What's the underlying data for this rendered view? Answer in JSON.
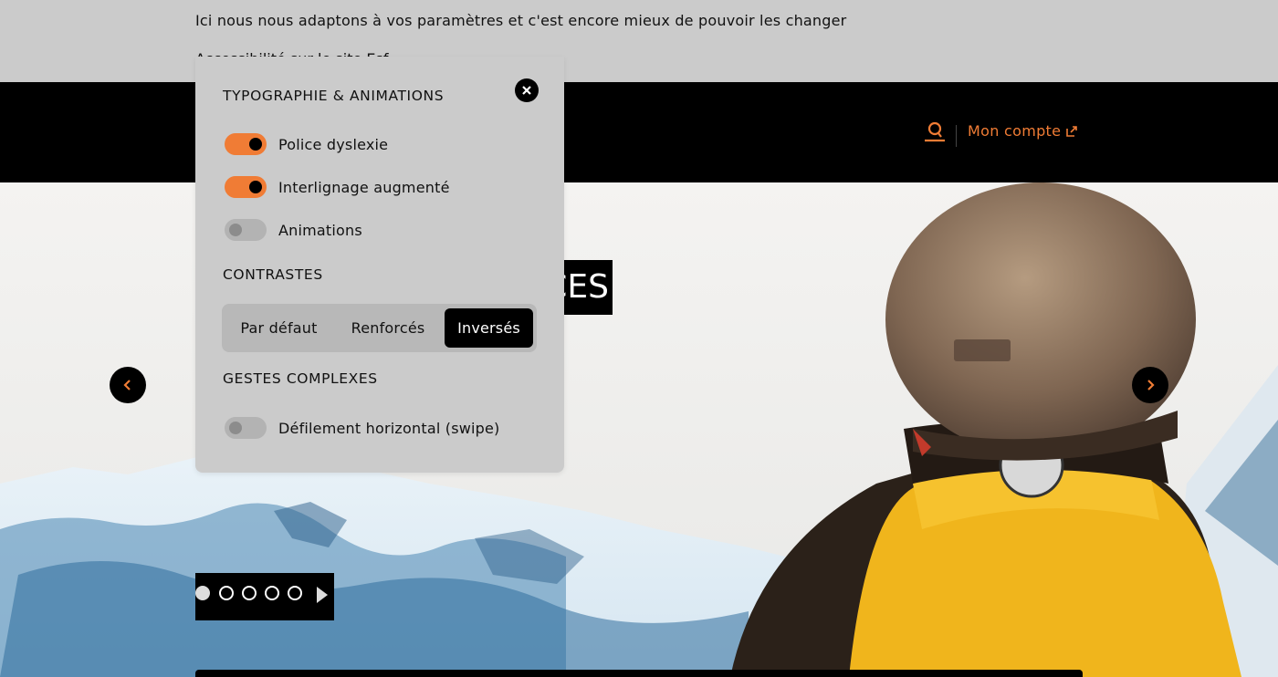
{
  "topbar": {
    "intro_text": "Ici nous nous adaptons à vos paramètres et c'est encore mieux de pouvoir les changer",
    "a11y_link_text": "Accessibilité sur le site Esf"
  },
  "header": {
    "account_label": "Mon compte",
    "icons": {
      "search": "search-icon",
      "external": "external-link-icon"
    }
  },
  "hero": {
    "title_fragment": "CES",
    "slides_count": 5,
    "active_slide": 1
  },
  "panel": {
    "sections": {
      "typography": "TYPOGRAPHIE & ANIMATIONS",
      "contrasts": "CONTRASTES",
      "gestures": "GESTES COMPLEXES"
    },
    "toggles": {
      "dyslexia": {
        "label": "Police dyslexie",
        "on": true
      },
      "line_spacing": {
        "label": "Interlignage augmenté",
        "on": true
      },
      "animations": {
        "label": "Animations",
        "on": false
      },
      "swipe": {
        "label": "Défilement horizontal (swipe)",
        "on": false
      }
    },
    "contrast_options": [
      "Par défaut",
      "Renforcés",
      "Inversés"
    ],
    "contrast_selected": "Inversés"
  },
  "colors": {
    "accent": "#f07c35",
    "header_bg": "#000000",
    "panel_bg": "#cbcbcb"
  }
}
